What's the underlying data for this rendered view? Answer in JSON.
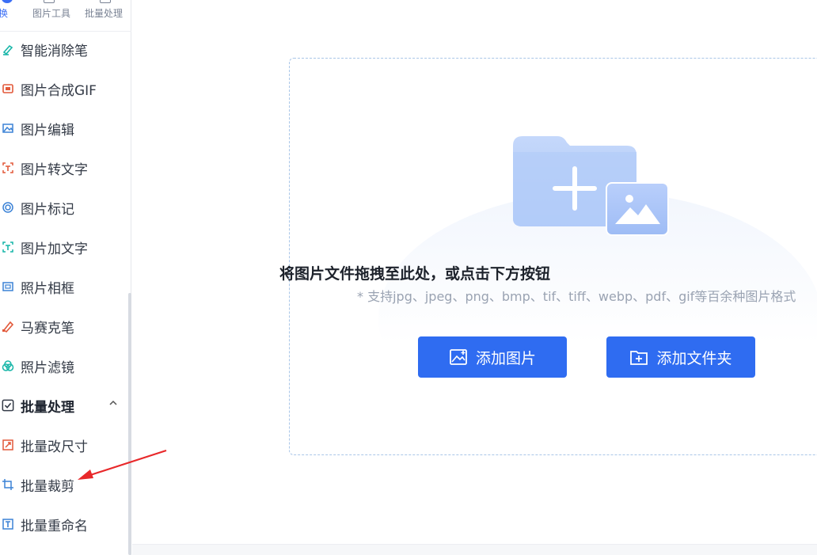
{
  "topnav": {
    "items": [
      {
        "label": "转换",
        "icon": "convert-icon"
      },
      {
        "label": "图片工具",
        "icon": "image-tools-icon"
      },
      {
        "label": "批量处理",
        "icon": "batch-icon"
      }
    ]
  },
  "sidebar": {
    "items": [
      {
        "label": "智能消除笔",
        "icon": "eraser-pen-icon"
      },
      {
        "label": "图片合成GIF",
        "icon": "gif-icon"
      },
      {
        "label": "图片编辑",
        "icon": "image-edit-icon"
      },
      {
        "label": "图片转文字",
        "icon": "image-to-text-icon"
      },
      {
        "label": "图片标记",
        "icon": "image-mark-icon"
      },
      {
        "label": "图片加文字",
        "icon": "add-text-icon"
      },
      {
        "label": "照片相框",
        "icon": "photo-frame-icon"
      },
      {
        "label": "马赛克笔",
        "icon": "mosaic-pen-icon"
      },
      {
        "label": "照片滤镜",
        "icon": "filter-icon"
      }
    ],
    "group": {
      "label": "批量处理",
      "icon": "batch-check-icon",
      "caret": "^"
    },
    "group_items": [
      {
        "label": "批量改尺寸",
        "icon": "resize-icon"
      },
      {
        "label": "批量裁剪",
        "icon": "crop-icon"
      },
      {
        "label": "批量重命名",
        "icon": "rename-icon"
      }
    ]
  },
  "dropzone": {
    "title": "将图片文件拖拽至此处，或点击下方按钮",
    "subtitle": "* 支持jpg、jpeg、png、bmp、tif、tiff、webp、pdf、gif等百余种图片格式"
  },
  "buttons": {
    "add_image": "添加图片",
    "add_folder": "添加文件夹"
  },
  "colors": {
    "accent": "#2f6cf1",
    "arrow": "#e8282a"
  }
}
